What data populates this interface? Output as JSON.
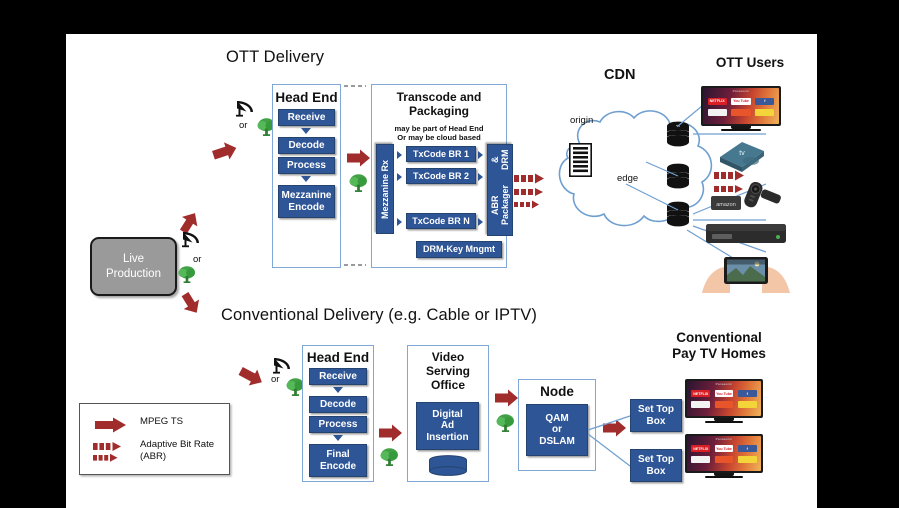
{
  "diagram": {
    "sections": {
      "ott_title": "OTT Delivery",
      "conventional_title": "Conventional Delivery (e.g. Cable or IPTV)"
    },
    "live_production": {
      "line1": "Live",
      "line2": "Production"
    },
    "or_labels": {
      "a": "or",
      "b": "or",
      "c": "or"
    },
    "ott": {
      "head_end": {
        "title": "Head End",
        "steps": [
          "Receive",
          "Decode",
          "Process",
          "Mezzanine Encode"
        ],
        "step4_line1": "Mezzanine",
        "step4_line2": "Encode"
      },
      "transcode": {
        "title_line1": "Transcode and",
        "title_line2": "Packaging",
        "subtitle_line1": "may be part of Head End",
        "subtitle_line2": "Or may be cloud based",
        "mezzanine_rx": "Mezzanine Rx",
        "ladders": [
          "TxCode BR 1",
          "TxCode BR 2",
          "TxCode BR N"
        ],
        "packager_line1": "ABR Packager",
        "packager_line2": "& DRM",
        "drm_key": "DRM-Key Mngmt"
      },
      "cdn": {
        "title": "CDN",
        "origin_label": "origin",
        "edge_label": "edge"
      },
      "users": {
        "title": "OTT Users",
        "devices": [
          "smart-tv",
          "apple-tv",
          "fire-tv-stick",
          "set-top-streamer",
          "smartphone"
        ]
      }
    },
    "conventional": {
      "head_end": {
        "title": "Head End",
        "steps": [
          "Receive",
          "Decode",
          "Process",
          "Final Encode"
        ],
        "step4_line1": "Final",
        "step4_line2": "Encode"
      },
      "vso": {
        "title_line1": "Video",
        "title_line2": "Serving",
        "title_line3": "Office",
        "box_line1": "Digital",
        "box_line2": "Ad",
        "box_line3": "Insertion"
      },
      "node": {
        "title": "Node",
        "box_line1": "QAM",
        "box_line2": "or",
        "box_line3": "DSLAM"
      },
      "homes": {
        "title_line1": "Conventional",
        "title_line2": "Pay TV Homes",
        "set_top_boxes": [
          "Set Top Box",
          "Set Top Box"
        ],
        "stb_line1": "Set Top",
        "stb_line2": "Box"
      }
    },
    "legend": {
      "items": [
        {
          "icon": "solid-red-arrow",
          "label": "MPEG TS"
        },
        {
          "icon": "dashed-red-arrow",
          "label_line1": "Adaptive Bit Rate",
          "label_line2": "(ABR)"
        }
      ],
      "mpeg_label": "MPEG TS",
      "abr_label_line1": "Adaptive Bit Rate",
      "abr_label_line2": "(ABR)"
    },
    "tv_tiles": {
      "row1": [
        "NETFLIX",
        "You Tube",
        "f"
      ],
      "row2": [
        "",
        "",
        ""
      ]
    },
    "colors": {
      "navy_box": "#2e5596",
      "panel_border": "#7fa8d6",
      "red_arrow": "#a02c2c",
      "tree_green": "#4caf50",
      "live_production_bg": "#9a9a9a",
      "canvas": "#000000",
      "slide": "#ffffff"
    }
  }
}
